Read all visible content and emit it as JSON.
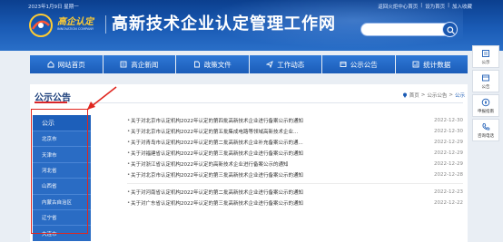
{
  "top": {
    "date": "2023年1月9日 星期一",
    "links": [
      "返回火炬中心首页",
      "|",
      "设为首页",
      "|",
      "加入收藏"
    ]
  },
  "logo": {
    "text": "高企认定",
    "sub": "INNOVATION COMPANY"
  },
  "site_title": "高新技术企业认定管理工作网",
  "search": {
    "placeholder": ""
  },
  "nav": [
    {
      "label": "网站首页",
      "icon": "home-icon"
    },
    {
      "label": "高企新闻",
      "icon": "news-icon"
    },
    {
      "label": "政策文件",
      "icon": "document-icon"
    },
    {
      "label": "工作动态",
      "icon": "send-icon"
    },
    {
      "label": "公示公告",
      "icon": "announcement-icon"
    },
    {
      "label": "统计数据",
      "icon": "chart-icon"
    }
  ],
  "page": {
    "title": "公示公告",
    "breadcrumb": [
      "首页",
      ">",
      "公示公告",
      ">",
      "公示"
    ]
  },
  "sidebar": {
    "header": "公示",
    "items": [
      "北京市",
      "天津市",
      "河北省",
      "山西省",
      "内蒙古自治区",
      "辽宁省",
      "大连市"
    ]
  },
  "notices": [
    {
      "title": "关于对北京市认定机构2022年认定的第四批高新技术企业进行备案公示的通知",
      "date": "2022-12-30"
    },
    {
      "title": "关于对北京市认定机构2022年认定的第五批集成电路等领域高新技术企业...",
      "date": "2022-12-30"
    },
    {
      "title": "关于对青岛市认定机构2022年认定的第二批高新技术企业补充备案公示的通...",
      "date": "2022-12-29"
    },
    {
      "title": "关于对福建省认定机构2022年认定的第三批高新技术企业进行备案公示的通知",
      "date": "2022-12-29"
    },
    {
      "title": "关于对浙江省认定机构2022年认定的高新技术企业进行备案公示的通知",
      "date": "2022-12-29"
    },
    {
      "title": "关于对北京市认定机构2022年认定的第三批高新技术企业进行备案公示的通知",
      "date": "2022-12-28"
    },
    {
      "title": "关于对河南省认定机构2022年认定的第二批高新技术企业进行备案公示的通知",
      "date": "2022-12-23"
    },
    {
      "title": "关于对广东省认定机构2022年认定的第三批高新技术企业进行备案公示的通知",
      "date": "2022-12-22"
    }
  ],
  "float_bar": [
    {
      "label": "公示",
      "icon": "notice-icon"
    },
    {
      "label": "公告",
      "icon": "announcement-icon"
    },
    {
      "label": "申报指南",
      "icon": "guide-icon"
    },
    {
      "label": "咨询电话",
      "icon": "phone-icon"
    }
  ],
  "colors": {
    "primary": "#1a5bb5",
    "highlight": "#e0261f"
  }
}
